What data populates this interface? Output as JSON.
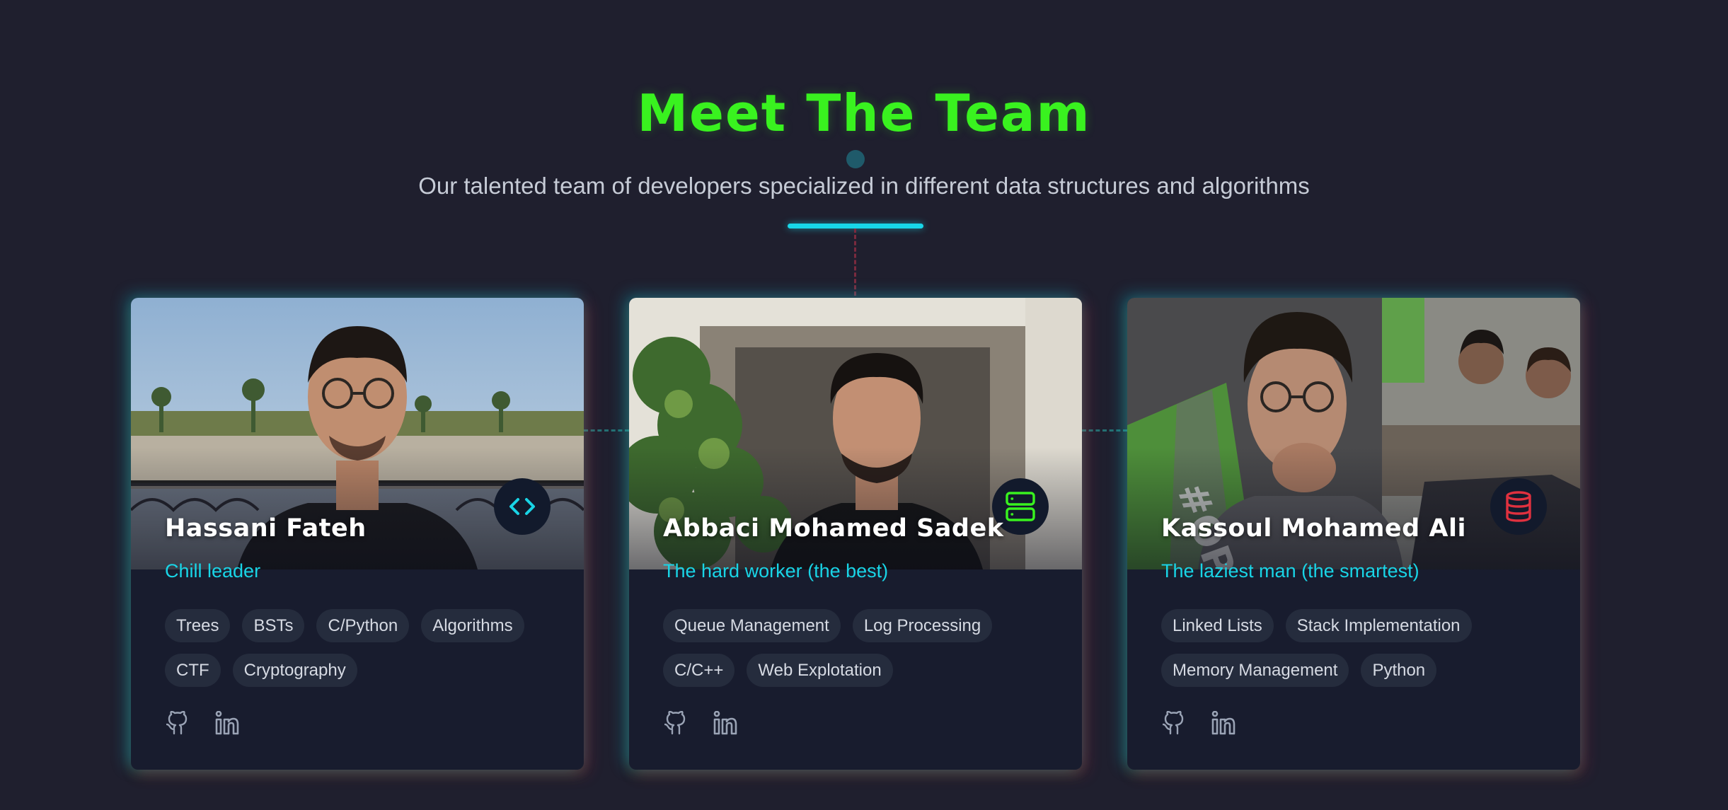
{
  "header": {
    "title": "Meet The Team",
    "subtitle": "Our talented team of developers specialized in different data structures and algorithms"
  },
  "colors": {
    "accent_green": "#39f21f",
    "accent_cyan": "#19d4e6",
    "accent_red": "#e0313f",
    "background": "#1f1f2e",
    "card_background": "#181c2e"
  },
  "members": [
    {
      "name": "Hassani Fateh",
      "role": "Chill leader",
      "badge_icon": "code-icon",
      "tags": [
        "Trees",
        "BSTs",
        "C/Python",
        "Algorithms",
        "CTF",
        "Cryptography"
      ],
      "socials": [
        "github-icon",
        "linkedin-icon"
      ]
    },
    {
      "name": "Abbaci Mohamed Sadek",
      "role": "The hard worker (the best)",
      "badge_icon": "server-icon",
      "tags": [
        "Queue Management",
        "Log Processing",
        "C/C++",
        "Web Explotation"
      ],
      "socials": [
        "github-icon",
        "linkedin-icon"
      ]
    },
    {
      "name": "Kassoul Mohamed Ali",
      "role": "The laziest man (the smartest)",
      "badge_icon": "database-icon",
      "tags": [
        "Linked Lists",
        "Stack Implementation",
        "Memory Management",
        "Python"
      ],
      "socials": [
        "github-icon",
        "linkedin-icon"
      ]
    }
  ]
}
